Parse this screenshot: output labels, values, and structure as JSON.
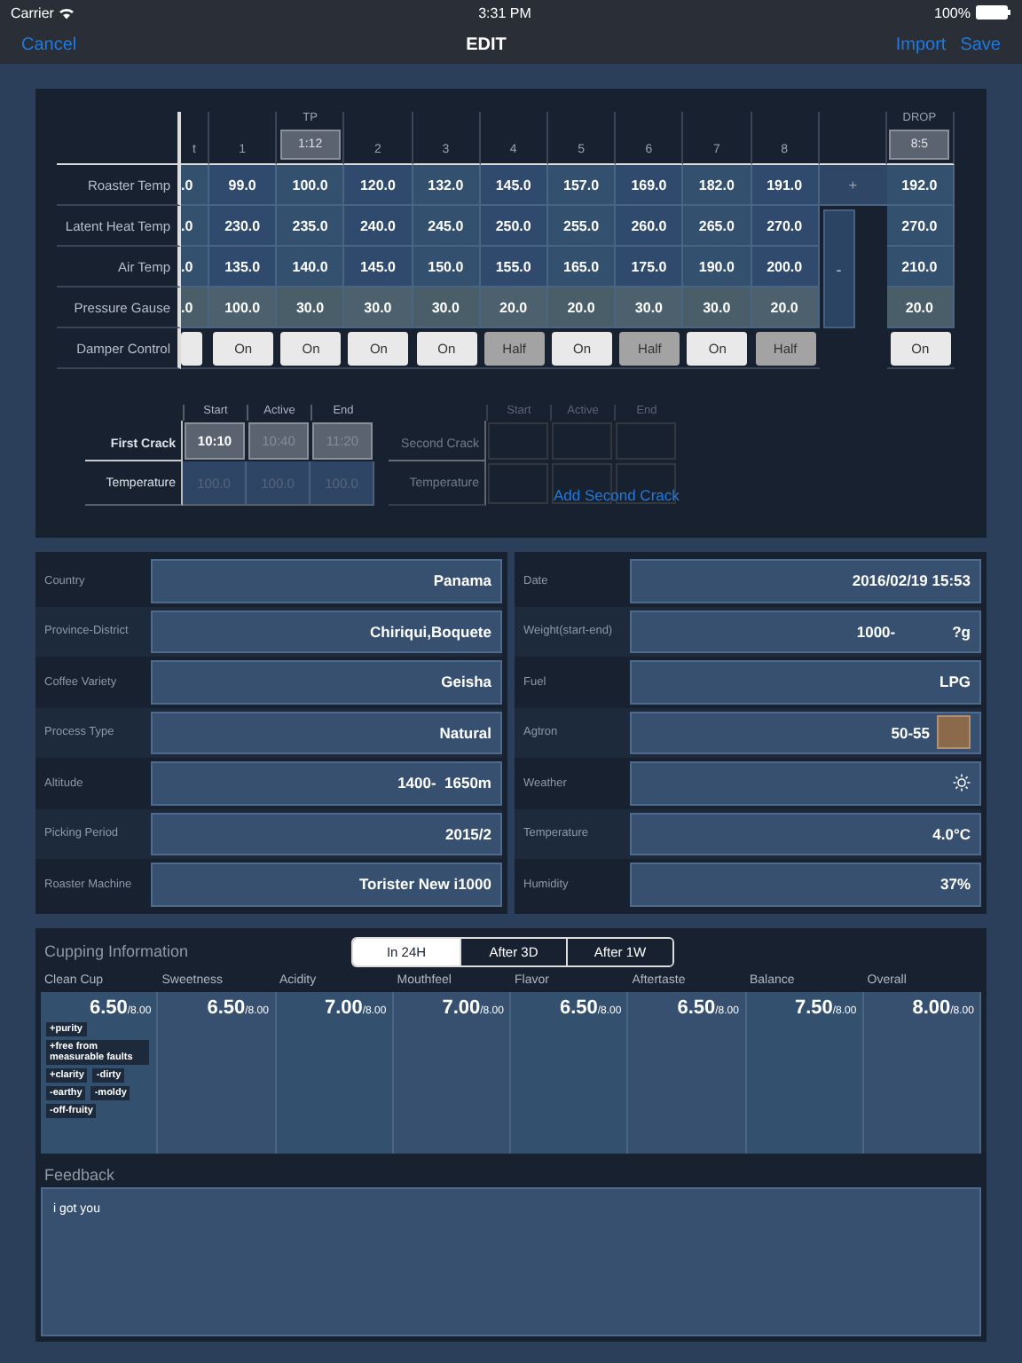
{
  "status_bar": {
    "carrier": "Carrier",
    "time": "3:31 PM",
    "battery": "100%"
  },
  "nav": {
    "cancel": "Cancel",
    "title": "EDIT",
    "import": "Import",
    "save": "Save"
  },
  "roast_table": {
    "columns": [
      {
        "kind": "clipped",
        "header": "t"
      },
      {
        "kind": "point",
        "header": "1"
      },
      {
        "kind": "event",
        "marker": "TP",
        "header": "1:12"
      },
      {
        "kind": "point",
        "header": "2"
      },
      {
        "kind": "point",
        "header": "3"
      },
      {
        "kind": "point",
        "header": "4"
      },
      {
        "kind": "point",
        "header": "5"
      },
      {
        "kind": "point",
        "header": "6"
      },
      {
        "kind": "point",
        "header": "7"
      },
      {
        "kind": "point",
        "header": "8"
      },
      {
        "kind": "event",
        "marker": "DROP",
        "header": "8:5"
      }
    ],
    "adjust": {
      "add": "+",
      "remove": "-"
    },
    "rows": [
      {
        "label": "Roaster Temp",
        "kind": "temperature",
        "values": [
          ".0",
          "99.0",
          "100.0",
          "120.0",
          "132.0",
          "145.0",
          "157.0",
          "169.0",
          "182.0",
          "191.0",
          "192.0"
        ]
      },
      {
        "label": "Latent Heat Temp",
        "kind": "temperature",
        "values": [
          ".0",
          "230.0",
          "235.0",
          "240.0",
          "245.0",
          "250.0",
          "255.0",
          "260.0",
          "265.0",
          "270.0",
          "270.0"
        ]
      },
      {
        "label": "Air Temp",
        "kind": "temperature",
        "values": [
          ".0",
          "135.0",
          "140.0",
          "145.0",
          "150.0",
          "155.0",
          "165.0",
          "175.0",
          "190.0",
          "200.0",
          "210.0"
        ]
      },
      {
        "label": "Pressure Gause",
        "kind": "pressure",
        "values": [
          ".0",
          "100.0",
          "30.0",
          "30.0",
          "30.0",
          "20.0",
          "20.0",
          "30.0",
          "30.0",
          "20.0",
          "20.0"
        ]
      }
    ],
    "damper_row": {
      "label": "Damper Control",
      "buttons": [
        {
          "half": false
        },
        {
          "label": "On",
          "half": false
        },
        {
          "label": "On",
          "half": false
        },
        {
          "label": "On",
          "half": false
        },
        {
          "label": "On",
          "half": false
        },
        {
          "label": "Half",
          "half": true
        },
        {
          "label": "On",
          "half": false
        },
        {
          "label": "Half",
          "half": true
        },
        {
          "label": "On",
          "half": false
        },
        {
          "label": "Half",
          "half": true
        },
        {
          "label": "On",
          "half": false
        }
      ]
    }
  },
  "first_crack": {
    "label": "First Crack",
    "temp_label": "Temperature",
    "stages": [
      {
        "header": "Start",
        "time": "10:10",
        "set": true,
        "temperature": "100.0"
      },
      {
        "header": "Active",
        "time": "10:40",
        "set": false,
        "temperature": "100.0"
      },
      {
        "header": "End",
        "time": "11:20",
        "set": false,
        "temperature": "100.0"
      }
    ]
  },
  "second_crack": {
    "label": "Second Crack",
    "temp_label": "Temperature",
    "headers": [
      "Start",
      "Active",
      "End"
    ],
    "add_link": "Add Second Crack"
  },
  "bean_info": [
    {
      "label": "Country",
      "value": "Panama"
    },
    {
      "label": "Province-District",
      "value": "Chiriqui,Boquete"
    },
    {
      "label": "Coffee Variety",
      "value": "Geisha"
    },
    {
      "label": "Process Type",
      "value": "Natural"
    },
    {
      "label": "Altitude",
      "value": "1400-  1650m"
    },
    {
      "label": "Picking Period",
      "value": "2015/2"
    },
    {
      "label": "Roaster Machine",
      "value": "Torister New i1000"
    }
  ],
  "roast_info": [
    {
      "label": "Date",
      "kind": "text",
      "value": "2016/02/19 15:53"
    },
    {
      "label": "Weight(start-end)",
      "kind": "range",
      "value": "1000-",
      "value_end": "?g"
    },
    {
      "label": "Fuel",
      "kind": "text",
      "value": "LPG"
    },
    {
      "label": "Agtron",
      "kind": "swatch",
      "value": "50-55",
      "color": "#8b6a4c"
    },
    {
      "label": "Weather",
      "kind": "weather"
    },
    {
      "label": "Temperature",
      "kind": "text",
      "value": "4.0°C"
    },
    {
      "label": "Humidity",
      "kind": "text",
      "value": "37%"
    }
  ],
  "cupping": {
    "title": "Cupping Information",
    "tabs": [
      {
        "label": "In 24H",
        "selected": true
      },
      {
        "label": "After 3D",
        "selected": false
      },
      {
        "label": "After 1W",
        "selected": false
      }
    ],
    "scores": [
      {
        "name": "Clean Cup",
        "score": "6.50",
        "max": "/8.00",
        "tags": [
          "+purity",
          "+free from measurable faults",
          "+clarity",
          "-dirty",
          "-earthy",
          "-moldy",
          "-off-fruity"
        ]
      },
      {
        "name": "Sweetness",
        "score": "6.50",
        "max": "/8.00"
      },
      {
        "name": "Acidity",
        "score": "7.00",
        "max": "/8.00"
      },
      {
        "name": "Mouthfeel",
        "score": "7.00",
        "max": "/8.00"
      },
      {
        "name": "Flavor",
        "score": "6.50",
        "max": "/8.00"
      },
      {
        "name": "Aftertaste",
        "score": "6.50",
        "max": "/8.00"
      },
      {
        "name": "Balance",
        "score": "7.50",
        "max": "/8.00"
      },
      {
        "name": "Overall",
        "score": "8.00",
        "max": "/8.00"
      }
    ],
    "feedback_label": "Feedback",
    "feedback": "i got you"
  }
}
